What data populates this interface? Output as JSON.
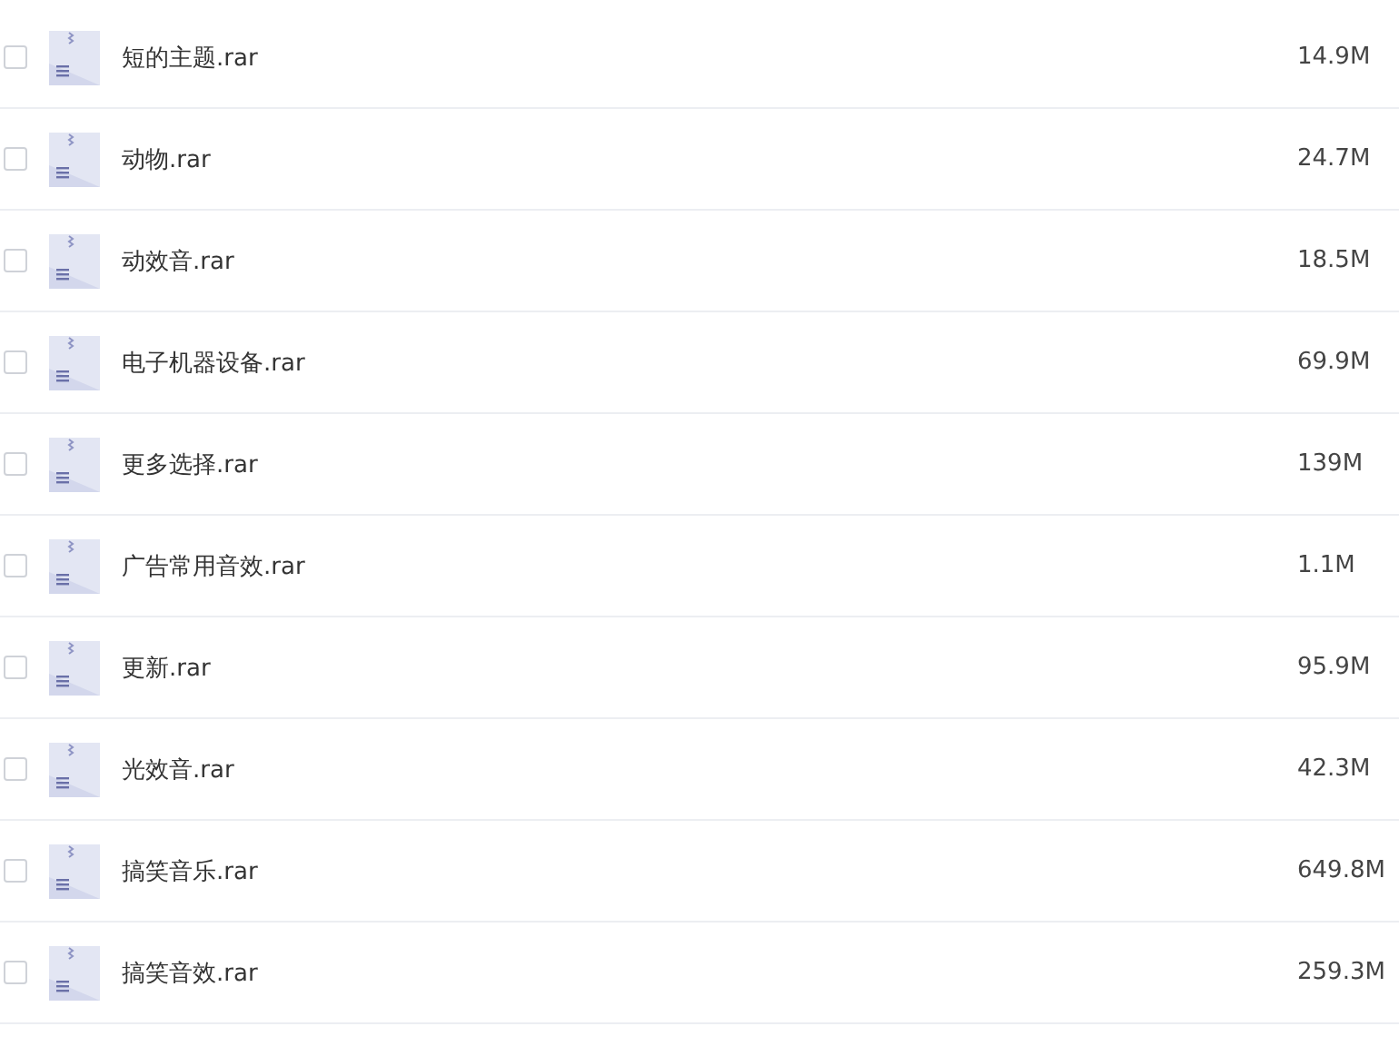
{
  "files": [
    {
      "name": "短的主题.rar",
      "size": "14.9M",
      "checked": false
    },
    {
      "name": "动物.rar",
      "size": "24.7M",
      "checked": false
    },
    {
      "name": "动效音.rar",
      "size": "18.5M",
      "checked": false
    },
    {
      "name": "电子机器设备.rar",
      "size": "69.9M",
      "checked": false
    },
    {
      "name": "更多选择.rar",
      "size": "139M",
      "checked": false
    },
    {
      "name": "广告常用音效.rar",
      "size": "1.1M",
      "checked": false
    },
    {
      "name": "更新.rar",
      "size": "95.9M",
      "checked": false
    },
    {
      "name": "光效音.rar",
      "size": "42.3M",
      "checked": false
    },
    {
      "name": "搞笑音乐.rar",
      "size": "649.8M",
      "checked": false
    },
    {
      "name": "搞笑音效.rar",
      "size": "259.3M",
      "checked": false
    }
  ]
}
